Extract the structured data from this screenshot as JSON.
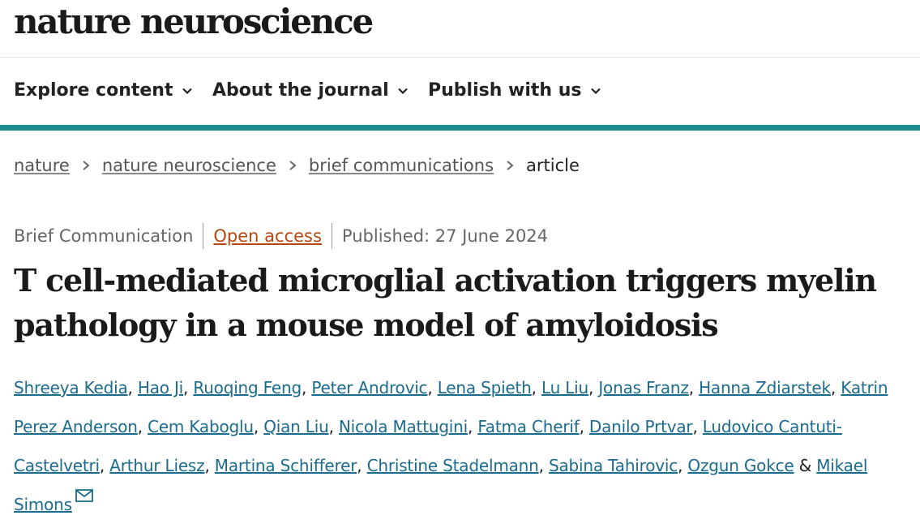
{
  "header": {
    "logo": "nature neuroscience"
  },
  "nav": {
    "items": [
      {
        "label": "Explore content"
      },
      {
        "label": "About the journal"
      },
      {
        "label": "Publish with us"
      }
    ]
  },
  "breadcrumb": {
    "items": [
      "nature",
      "nature neuroscience",
      "brief communications"
    ],
    "current": "article"
  },
  "article": {
    "type": "Brief Communication",
    "access": "Open access",
    "published": "Published: 27 June 2024",
    "title": "T cell-mediated microglial activation triggers myelin pathology in a mouse model of amyloidosis",
    "authors": [
      "Shreeya Kedia",
      "Hao Ji",
      "Ruoqing Feng",
      "Peter Androvic",
      "Lena Spieth",
      "Lu Liu",
      "Jonas Franz",
      "Hanna Zdiarstek",
      "Katrin Perez Anderson",
      "Cem Kaboglu",
      "Qian Liu",
      "Nicola Mattugini",
      "Fatma Cherif",
      "Danilo Prtvar",
      "Ludovico Cantuti-Castelvetri",
      "Arthur Liesz",
      "Martina Schifferer",
      "Christine Stadelmann",
      "Sabina Tahirovic",
      "Ozgun Gokce",
      "Mikael Simons"
    ],
    "author_separator": ",",
    "last_author_connector": "&"
  },
  "colors": {
    "accent": "#1b8c8c",
    "link": "#1b6b8c",
    "open_access": "#b4480f"
  },
  "icons": {
    "nav_chevron": "chevron-down-icon",
    "breadcrumb_separator": "chevron-right-icon",
    "corresponding_author": "mail-icon"
  }
}
